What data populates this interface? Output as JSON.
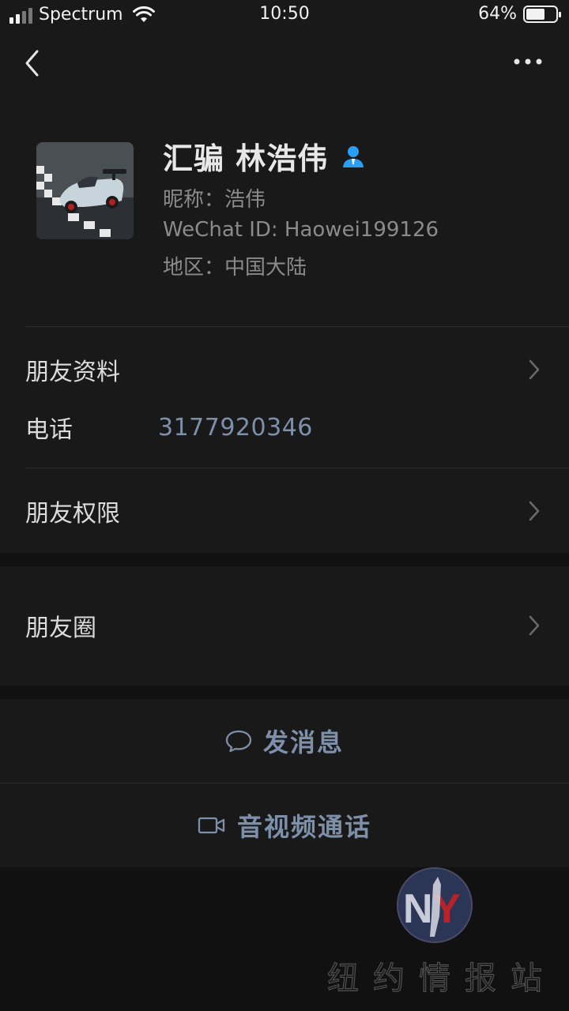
{
  "status_bar": {
    "carrier": "Spectrum",
    "time": "10:50",
    "battery_percent": "64%",
    "battery_level": 0.64,
    "icons": [
      "signal-icon",
      "wifi-icon",
      "battery-icon"
    ]
  },
  "nav": {
    "icons": [
      "back-chevron-icon",
      "more-dots-icon"
    ]
  },
  "profile": {
    "name": "汇骗 林浩伟",
    "nickname": "昵称：浩伟",
    "wechat_id": "WeChat ID: Haowei199126",
    "region": "地区：中国大陆",
    "badge_icon": "contact-person-icon",
    "badge_color": "#2a9df4"
  },
  "info": {
    "friend_profile_label": "朋友资料",
    "phone_label": "电话",
    "phone_value": "3177920346",
    "permissions_label": "朋友权限"
  },
  "moments": {
    "label": "朋友圈"
  },
  "actions": {
    "message_label": "发消息",
    "message_icon": "chat-bubble-icon",
    "call_label": "音视频通话",
    "call_icon": "video-camera-icon"
  },
  "watermark": {
    "text": "纽约情报站",
    "logo_letters": "NY"
  },
  "colors": {
    "background": "#111111",
    "panel": "#191919",
    "link_blue": "#7d90aa"
  }
}
